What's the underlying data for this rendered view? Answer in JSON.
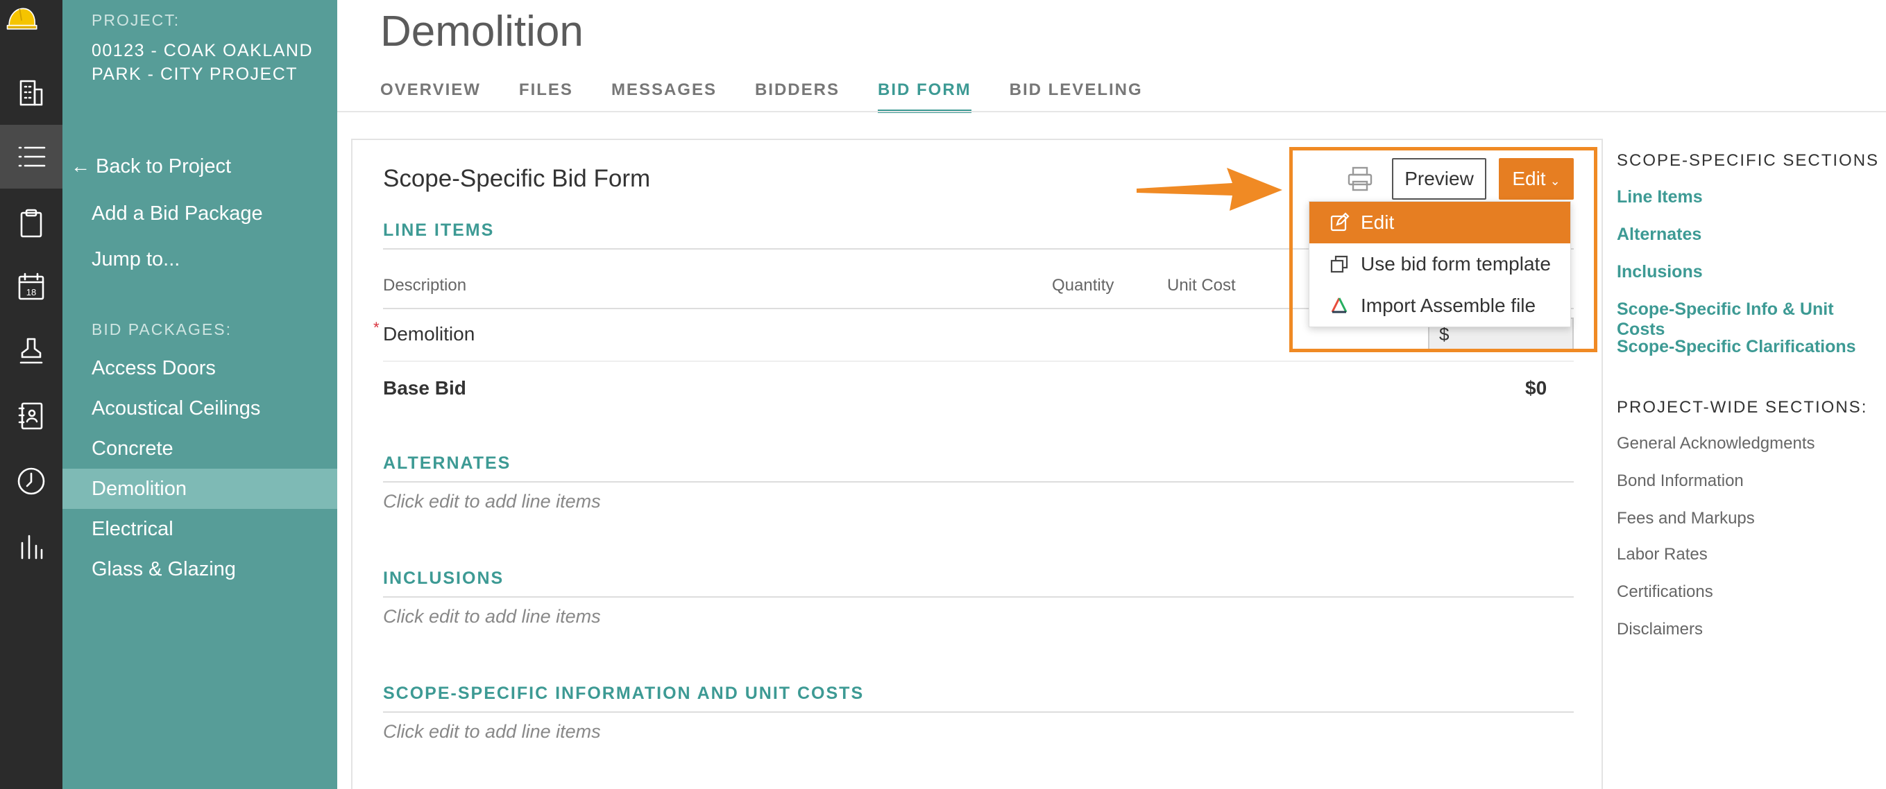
{
  "rail": {
    "icons": [
      "hardhat-logo-icon",
      "building-icon",
      "list-icon",
      "clipboard-icon",
      "calendar-icon",
      "stamp-icon",
      "contacts-book-icon",
      "clock-icon",
      "bar-chart-icon"
    ],
    "calendar_day": "18"
  },
  "sidebar": {
    "project_label": "PROJECT:",
    "project_name": "00123 - COAK OAKLAND PARK - CITY PROJECT",
    "back": "Back to Project",
    "add_package": "Add a Bid Package",
    "jump": "Jump to...",
    "packages_label": "BID PACKAGES:",
    "packages": [
      "Access Doors",
      "Acoustical Ceilings",
      "Concrete",
      "Demolition",
      "Electrical",
      "Glass & Glazing"
    ],
    "active_package": "Demolition"
  },
  "header": {
    "title": "Demolition",
    "tabs": [
      "OVERVIEW",
      "FILES",
      "MESSAGES",
      "BIDDERS",
      "BID FORM",
      "BID LEVELING"
    ],
    "active_tab": "BID FORM"
  },
  "form": {
    "title": "Scope-Specific Bid Form",
    "preview_label": "Preview",
    "edit_label": "Edit",
    "line_items_heading": "LINE ITEMS",
    "columns": {
      "description": "Description",
      "quantity": "Quantity",
      "unit_cost": "Unit Cost"
    },
    "row_description": "Demolition",
    "row_currency": "$",
    "required_marker": "*",
    "base_bid_label": "Base Bid",
    "base_bid_value": "$0",
    "alternates_heading": "ALTERNATES",
    "inclusions_heading": "INCLUSIONS",
    "scope_heading": "SCOPE-SPECIFIC INFORMATION AND UNIT COSTS",
    "empty_text": "Click edit to add line items"
  },
  "edit_menu": {
    "items": [
      "Edit",
      "Use bid form template",
      "Import Assemble file"
    ],
    "active_item": "Edit"
  },
  "right_rail": {
    "scope_heading": "SCOPE-SPECIFIC SECTIONS",
    "scope_links": [
      "Line Items",
      "Alternates",
      "Inclusions",
      "Scope-Specific Info & Unit Costs",
      "Scope-Specific Clarifications"
    ],
    "project_heading": "PROJECT-WIDE SECTIONS:",
    "project_links": [
      "General Acknowledgments",
      "Bond Information",
      "Fees and Markups",
      "Labor Rates",
      "Certifications",
      "Disclaimers"
    ]
  },
  "colors": {
    "teal": "#579d98",
    "accent": "#3d9a94",
    "orange": "#e67e22",
    "rail": "#2b2b2b"
  }
}
